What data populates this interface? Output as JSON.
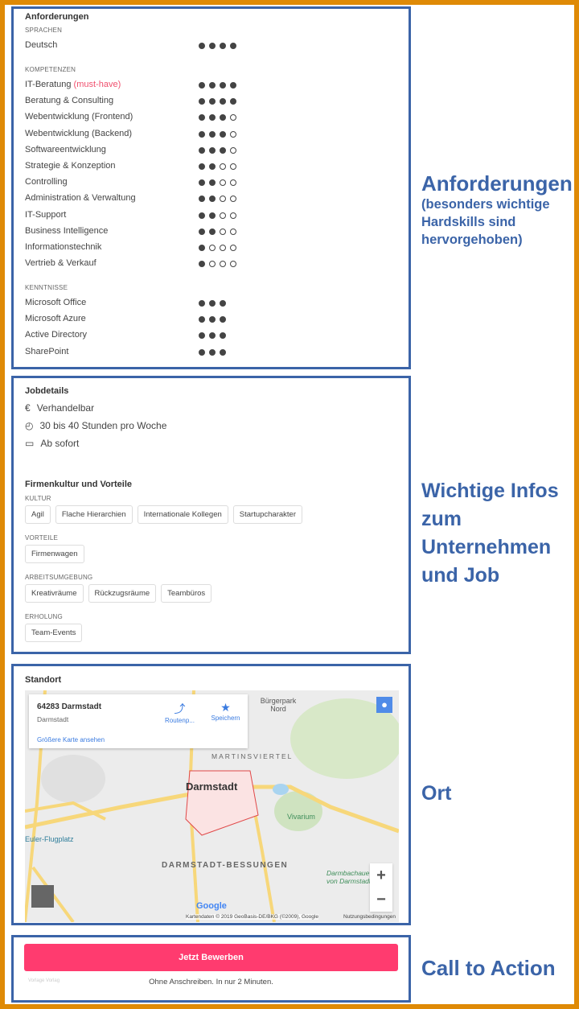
{
  "requirements": {
    "title": "Anforderungen",
    "languages_caption": "SPRACHEN",
    "languages": [
      {
        "label": "Deutsch",
        "level": 4,
        "max": 4
      }
    ],
    "skills_caption": "KOMPETENZEN",
    "must_have": "(must-have)",
    "skills": [
      {
        "label": "IT-Beratung",
        "level": 4,
        "max": 4,
        "must": true
      },
      {
        "label": "Beratung & Consulting",
        "level": 4,
        "max": 4
      },
      {
        "label": "Webentwicklung (Frontend)",
        "level": 3,
        "max": 4
      },
      {
        "label": "Webentwicklung (Backend)",
        "level": 3,
        "max": 4
      },
      {
        "label": "Softwareentwicklung",
        "level": 3,
        "max": 4
      },
      {
        "label": "Strategie & Konzeption",
        "level": 2,
        "max": 4
      },
      {
        "label": "Controlling",
        "level": 2,
        "max": 4
      },
      {
        "label": "Administration & Verwaltung",
        "level": 2,
        "max": 4
      },
      {
        "label": "IT-Support",
        "level": 2,
        "max": 4
      },
      {
        "label": "Business Intelligence",
        "level": 2,
        "max": 4
      },
      {
        "label": "Informationstechnik",
        "level": 1,
        "max": 4
      },
      {
        "label": "Vertrieb & Verkauf",
        "level": 1,
        "max": 4
      }
    ],
    "knowledge_caption": "KENNTNISSE",
    "knowledge": [
      {
        "label": "Microsoft Office",
        "level": 3,
        "max": 3
      },
      {
        "label": "Microsoft Azure",
        "level": 3,
        "max": 3
      },
      {
        "label": "Active Directory",
        "level": 3,
        "max": 3
      },
      {
        "label": "SharePoint",
        "level": 3,
        "max": 3
      }
    ]
  },
  "jobdetails": {
    "title": "Jobdetails",
    "items": [
      {
        "icon": "euro-icon",
        "glyph": "€",
        "text": "Verhandelbar"
      },
      {
        "icon": "clock-icon",
        "glyph": "◴",
        "text": "30 bis 40 Stunden pro Woche"
      },
      {
        "icon": "calendar-icon",
        "glyph": "▭",
        "text": "Ab sofort"
      }
    ]
  },
  "culture": {
    "title": "Firmenkultur und Vorteile",
    "groups": [
      {
        "caption": "KULTUR",
        "tags": [
          "Agil",
          "Flache Hierarchien",
          "Internationale Kollegen",
          "Startupcharakter"
        ]
      },
      {
        "caption": "VORTEILE",
        "tags": [
          "Firmenwagen"
        ]
      },
      {
        "caption": "ARBEITSUMGEBUNG",
        "tags": [
          "Kreativräume",
          "Rückzugsräume",
          "Teambüros"
        ]
      },
      {
        "caption": "ERHOLUNG",
        "tags": [
          "Team-Events"
        ]
      }
    ]
  },
  "location": {
    "title": "Standort",
    "card_title": "64283 Darmstadt",
    "card_sub": "Darmstadt",
    "route": "Routenp...",
    "save": "Speichern",
    "larger_map": "Größere Karte ansehen",
    "labels": {
      "city": "Darmstadt",
      "north": "Bürgerpark Nord",
      "martin": "MARTINSVIERTEL",
      "bessungen": "DARMSTADT-BESSUNGEN",
      "vivarium": "Vivarium",
      "airport": "Euler-Flugplatz",
      "darmbach": "Darmbachaue von Darmstadt"
    },
    "attribution": "Kartendaten © 2019 GeoBasis-DE/BKG (©2009), Google",
    "terms": "Nutzungsbedingungen",
    "google": "Google",
    "zoom_in": "+",
    "zoom_out": "−"
  },
  "cta": {
    "button": "Jetzt Bewerben",
    "note": "Ohne Anschreiben. In nur 2 Minuten.",
    "small": "Vorlage Vorlag",
    "color": "#FF3B6F"
  },
  "annotations": {
    "a1": "Anforderungen",
    "a1_sub": "(besonders wichtige Hardskills sind hervorgehoben)",
    "a2": "Wichtige Infos zum Unternehmen und Job",
    "a3": "Ort",
    "a4": "Call to Action"
  }
}
